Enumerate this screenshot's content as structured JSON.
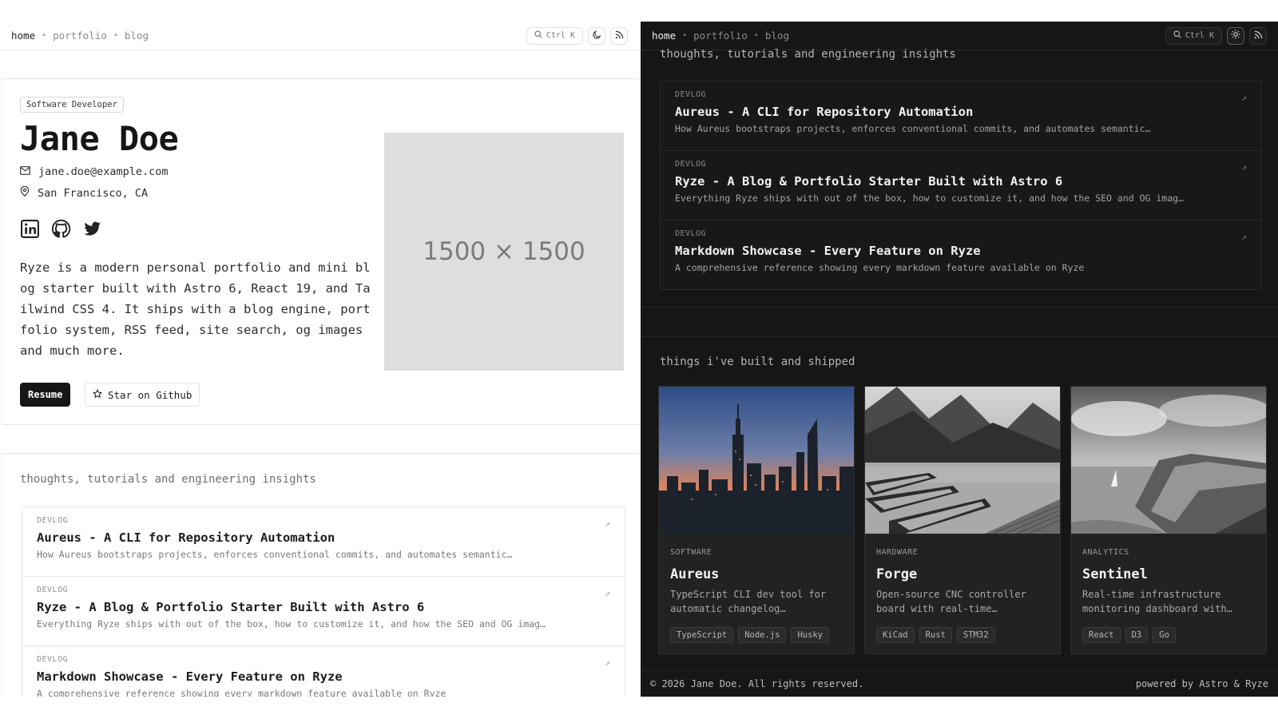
{
  "nav": {
    "home": "home",
    "portfolio": "portfolio",
    "blog": "blog",
    "separator": "•",
    "search_shortcut": "Ctrl K"
  },
  "hero": {
    "badge": "Software Developer",
    "name": "Jane Doe",
    "email": "jane.doe@example.com",
    "location": "San Francisco, CA",
    "bio": "Ryze is a modern personal portfolio and mini blog starter built with Astro 6, React 19, and Tailwind CSS 4. It ships with a blog engine, portfolio system, RSS feed, site search, og images and much more.",
    "resume_label": "Resume",
    "star_label": "Star on Github",
    "image_placeholder": "1500 × 1500"
  },
  "blog": {
    "tagline": "thoughts, tutorials and engineering insights",
    "posts": [
      {
        "category": "DEVLOG",
        "title": "Aureus - A CLI for Repository Automation",
        "description": "How Aureus bootstraps projects, enforces conventional commits, and automates semantic…"
      },
      {
        "category": "DEVLOG",
        "title": "Ryze - A Blog & Portfolio Starter Built with Astro 6",
        "description": "Everything Ryze ships with out of the box, how to customize it, and how the SEO and OG imag…"
      },
      {
        "category": "DEVLOG",
        "title": "Markdown Showcase - Every Feature on Ryze",
        "description": "A comprehensive reference showing every markdown feature available on Ryze"
      }
    ]
  },
  "projects": {
    "tagline": "things i've built and shipped",
    "items": [
      {
        "category": "SOFTWARE",
        "title": "Aureus",
        "description": "TypeScript CLI dev tool for automatic changelog…",
        "tags": [
          "TypeScript",
          "Node.js",
          "Husky"
        ]
      },
      {
        "category": "HARDWARE",
        "title": "Forge",
        "description": "Open-source CNC controller board with real-time…",
        "tags": [
          "KiCad",
          "Rust",
          "STM32"
        ]
      },
      {
        "category": "ANALYTICS",
        "title": "Sentinel",
        "description": "Real-time infrastructure monitoring dashboard with…",
        "tags": [
          "React",
          "D3",
          "Go"
        ]
      }
    ]
  },
  "footer": {
    "copyright": "© 2026 Jane Doe. All rights reserved.",
    "powered": "powered by Astro & Ryze"
  },
  "icons": {
    "search": "search-icon",
    "theme_dark": "moon-icon",
    "theme_light": "sun-icon",
    "rss": "rss-icon",
    "email": "mail-icon",
    "location": "map-pin-icon",
    "linkedin": "linkedin-icon",
    "github": "github-icon",
    "twitter": "twitter-icon",
    "star": "star-icon",
    "external": "external-link-icon"
  },
  "colors": {
    "light_bg": "#ffffff",
    "dark_bg": "#161616",
    "primary_button": "#161616",
    "placeholder": "#dedede"
  }
}
